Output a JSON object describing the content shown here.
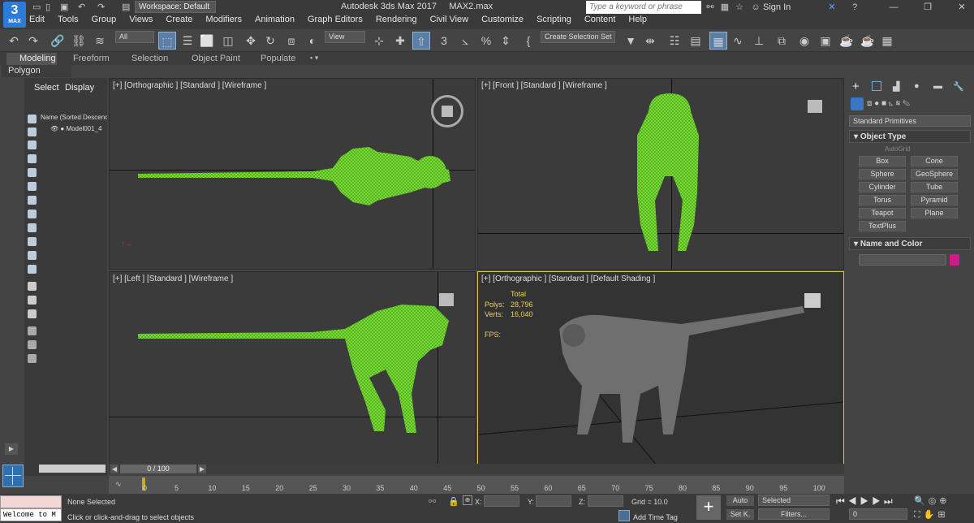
{
  "app": {
    "title": "Autodesk 3ds Max 2017",
    "file": "MAX2.max",
    "workspace": "Workspace: Default",
    "logo": "3",
    "logo_sub": "MAX",
    "sign_in": "Sign In",
    "search_placeholder": "Type a keyword or phrase"
  },
  "menu": [
    "Edit",
    "Tools",
    "Group",
    "Views",
    "Create",
    "Modifiers",
    "Animation",
    "Graph Editors",
    "Rendering",
    "Civil View",
    "Customize",
    "Scripting",
    "Content",
    "Help"
  ],
  "toolbar": {
    "filter": "All",
    "view": "View",
    "selection_set": "Create Selection Set"
  },
  "ribbon": {
    "tabs": [
      "Modeling",
      "Freeform",
      "Selection",
      "Object Paint",
      "Populate"
    ],
    "sub": "Polygon Modeling"
  },
  "scene_explorer": {
    "tabs": [
      "Select",
      "Display"
    ],
    "column": "Name (Sorted Descenc",
    "item": "Model001_4"
  },
  "viewports": [
    {
      "label": "[+] [Orthographic ] [Standard ] [Wireframe ]"
    },
    {
      "label": "[+] [Front ] [Standard ] [Wireframe ]"
    },
    {
      "label": "[+] [Left ] [Standard ] [Wireframe ]"
    },
    {
      "label": "[+] [Orthographic ] [Standard ] [Default Shading ]"
    }
  ],
  "stats": {
    "total": "Total",
    "polys_label": "Polys:",
    "polys": "28,796",
    "verts_label": "Verts:",
    "verts": "16,040",
    "fps_label": "FPS:"
  },
  "command_panel": {
    "category": "Standard Primitives",
    "object_type": "Object Type",
    "autogrid": "AutoGrid",
    "buttons": [
      "Box",
      "Cone",
      "Sphere",
      "GeoSphere",
      "Cylinder",
      "Tube",
      "Torus",
      "Pyramid",
      "Teapot",
      "Plane",
      "TextPlus"
    ],
    "name_color": "Name and Color"
  },
  "timeline": {
    "frame": "0 / 100",
    "ticks": [
      "5",
      "10",
      "15",
      "20",
      "25",
      "30",
      "35",
      "40",
      "45",
      "50",
      "55",
      "60",
      "65",
      "70",
      "75",
      "80",
      "85",
      "90",
      "95",
      "100"
    ],
    "tick0": "0"
  },
  "status": {
    "script": "Welcome to M",
    "selected": "None Selected",
    "hint": "Click or click-and-drag to select objects",
    "x_label": "X:",
    "y_label": "Y:",
    "z_label": "Z:",
    "grid": "Grid = 10.0",
    "add_time_tag": "Add Time Tag",
    "auto": "Auto",
    "set_key": "Set K.",
    "selected_dd": "Selected",
    "filters": "Filters...",
    "frame": "0"
  },
  "colors": {
    "wire": "#7fe03a",
    "accent": "#5b7ea6",
    "swatch": "#d21b8a"
  }
}
